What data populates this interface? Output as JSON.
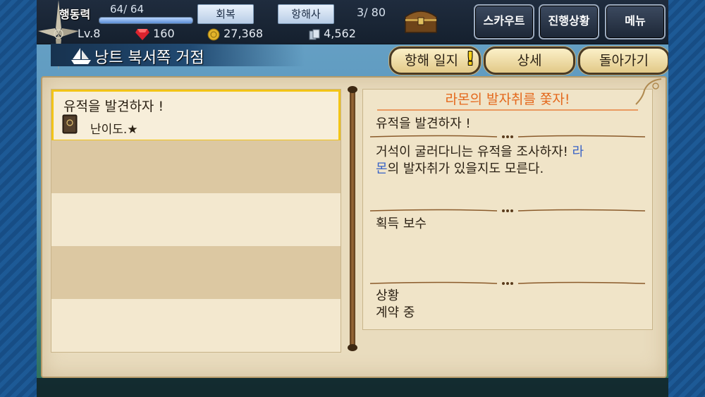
{
  "status": {
    "stamina_label": "행동력",
    "stamina_value": "64/ 64",
    "stamina_fraction": 1.0,
    "recover_button": "회복",
    "navigator_button": "항해사",
    "crew_count": "3/ 80",
    "level": "Lv.8",
    "gems": "160",
    "gold": "27,368",
    "silver": "4,562"
  },
  "nav": {
    "scout": "스카우트",
    "progress": "진행상황",
    "menu": "메뉴"
  },
  "location": {
    "title": "낭트 북서쪽 거점"
  },
  "actions": {
    "log": "항해 일지",
    "log_alert": "!",
    "details": "상세",
    "back": "돌아가기"
  },
  "quest_list": {
    "items": [
      {
        "name": "유적을 발견하자 !",
        "difficulty": "난이도.★"
      }
    ]
  },
  "detail": {
    "header": "라몬의 발자취를 쫓자!",
    "quest_name": "유적을 발견하자 !",
    "desc_line1_a": "거석이 굴러다니는 유적을 조사하자! ",
    "desc_line1_b": "라",
    "desc_line2_a": "몬",
    "desc_line2_b": "의 발자취가 있을지도 모른다.",
    "reward_label": "획득 보수",
    "status_label": "상황",
    "status_value": "계약 중"
  },
  "colors": {
    "accent_orange": "#e4681c",
    "highlight_blue": "#3a63c6",
    "selected_border": "#f2c418",
    "parchment": "#e9dcbe"
  }
}
